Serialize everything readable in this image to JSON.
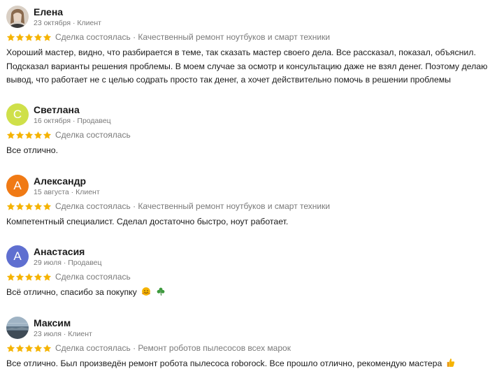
{
  "reviews": [
    {
      "name": "Елена",
      "meta": "23 октября · Клиент",
      "avatar_type": "photo-portrait",
      "rating": 5,
      "deal": "Сделка состоялась · Качественный ремонт ноутбуков и смарт техники",
      "text": "Хороший мастер, видно, что разбирается в теме, так сказать мастер своего дела. Все рассказал, показал, объяснил. Подсказал варианты решения проблемы. В моем случае за осмотр и консультацию даже не взял денег. Поэтому делаю вывод, что работает не с целью содрать просто так денег, а хочет действительно помочь в решении проблемы"
    },
    {
      "name": "Светлана",
      "meta": "16 октября · Продавец",
      "avatar_type": "letter",
      "avatar_letter": "С",
      "avatar_color": "#cfe04a",
      "rating": 5,
      "deal": "Сделка состоялась",
      "text": "Все отлично."
    },
    {
      "name": "Александр",
      "meta": "15 августа · Клиент",
      "avatar_type": "letter",
      "avatar_letter": "А",
      "avatar_color": "#f07a15",
      "rating": 5,
      "deal": "Сделка состоялась · Качественный ремонт ноутбуков и смарт техники",
      "text": "Компетентный специалист. Сделал достаточно быстро, ноут работает."
    },
    {
      "name": "Анастасия",
      "meta": "29 июля · Продавец",
      "avatar_type": "letter",
      "avatar_letter": "А",
      "avatar_color": "#5f6fd0",
      "rating": 5,
      "deal": "Сделка состоялась",
      "text": "Всё отлично, спасибо за покупку",
      "emojis": [
        "hugging-face-emoji-icon",
        "shamrock-emoji-icon"
      ]
    },
    {
      "name": "Максим",
      "meta": "23 июля · Клиент",
      "avatar_type": "photo-seascape",
      "rating": 5,
      "deal": "Сделка состоялась · Ремонт роботов пылесосов всех марок",
      "text": "Все отлично. Был произведён ремонт робота пылесоса roborock. Все прошло отлично, рекомендую мастера",
      "emojis": [
        "thumbs-up-emoji-icon"
      ]
    }
  ],
  "colors": {
    "star": "#f5b301",
    "meta_text": "#7a7a7a",
    "body_text": "#1a1a1a"
  }
}
